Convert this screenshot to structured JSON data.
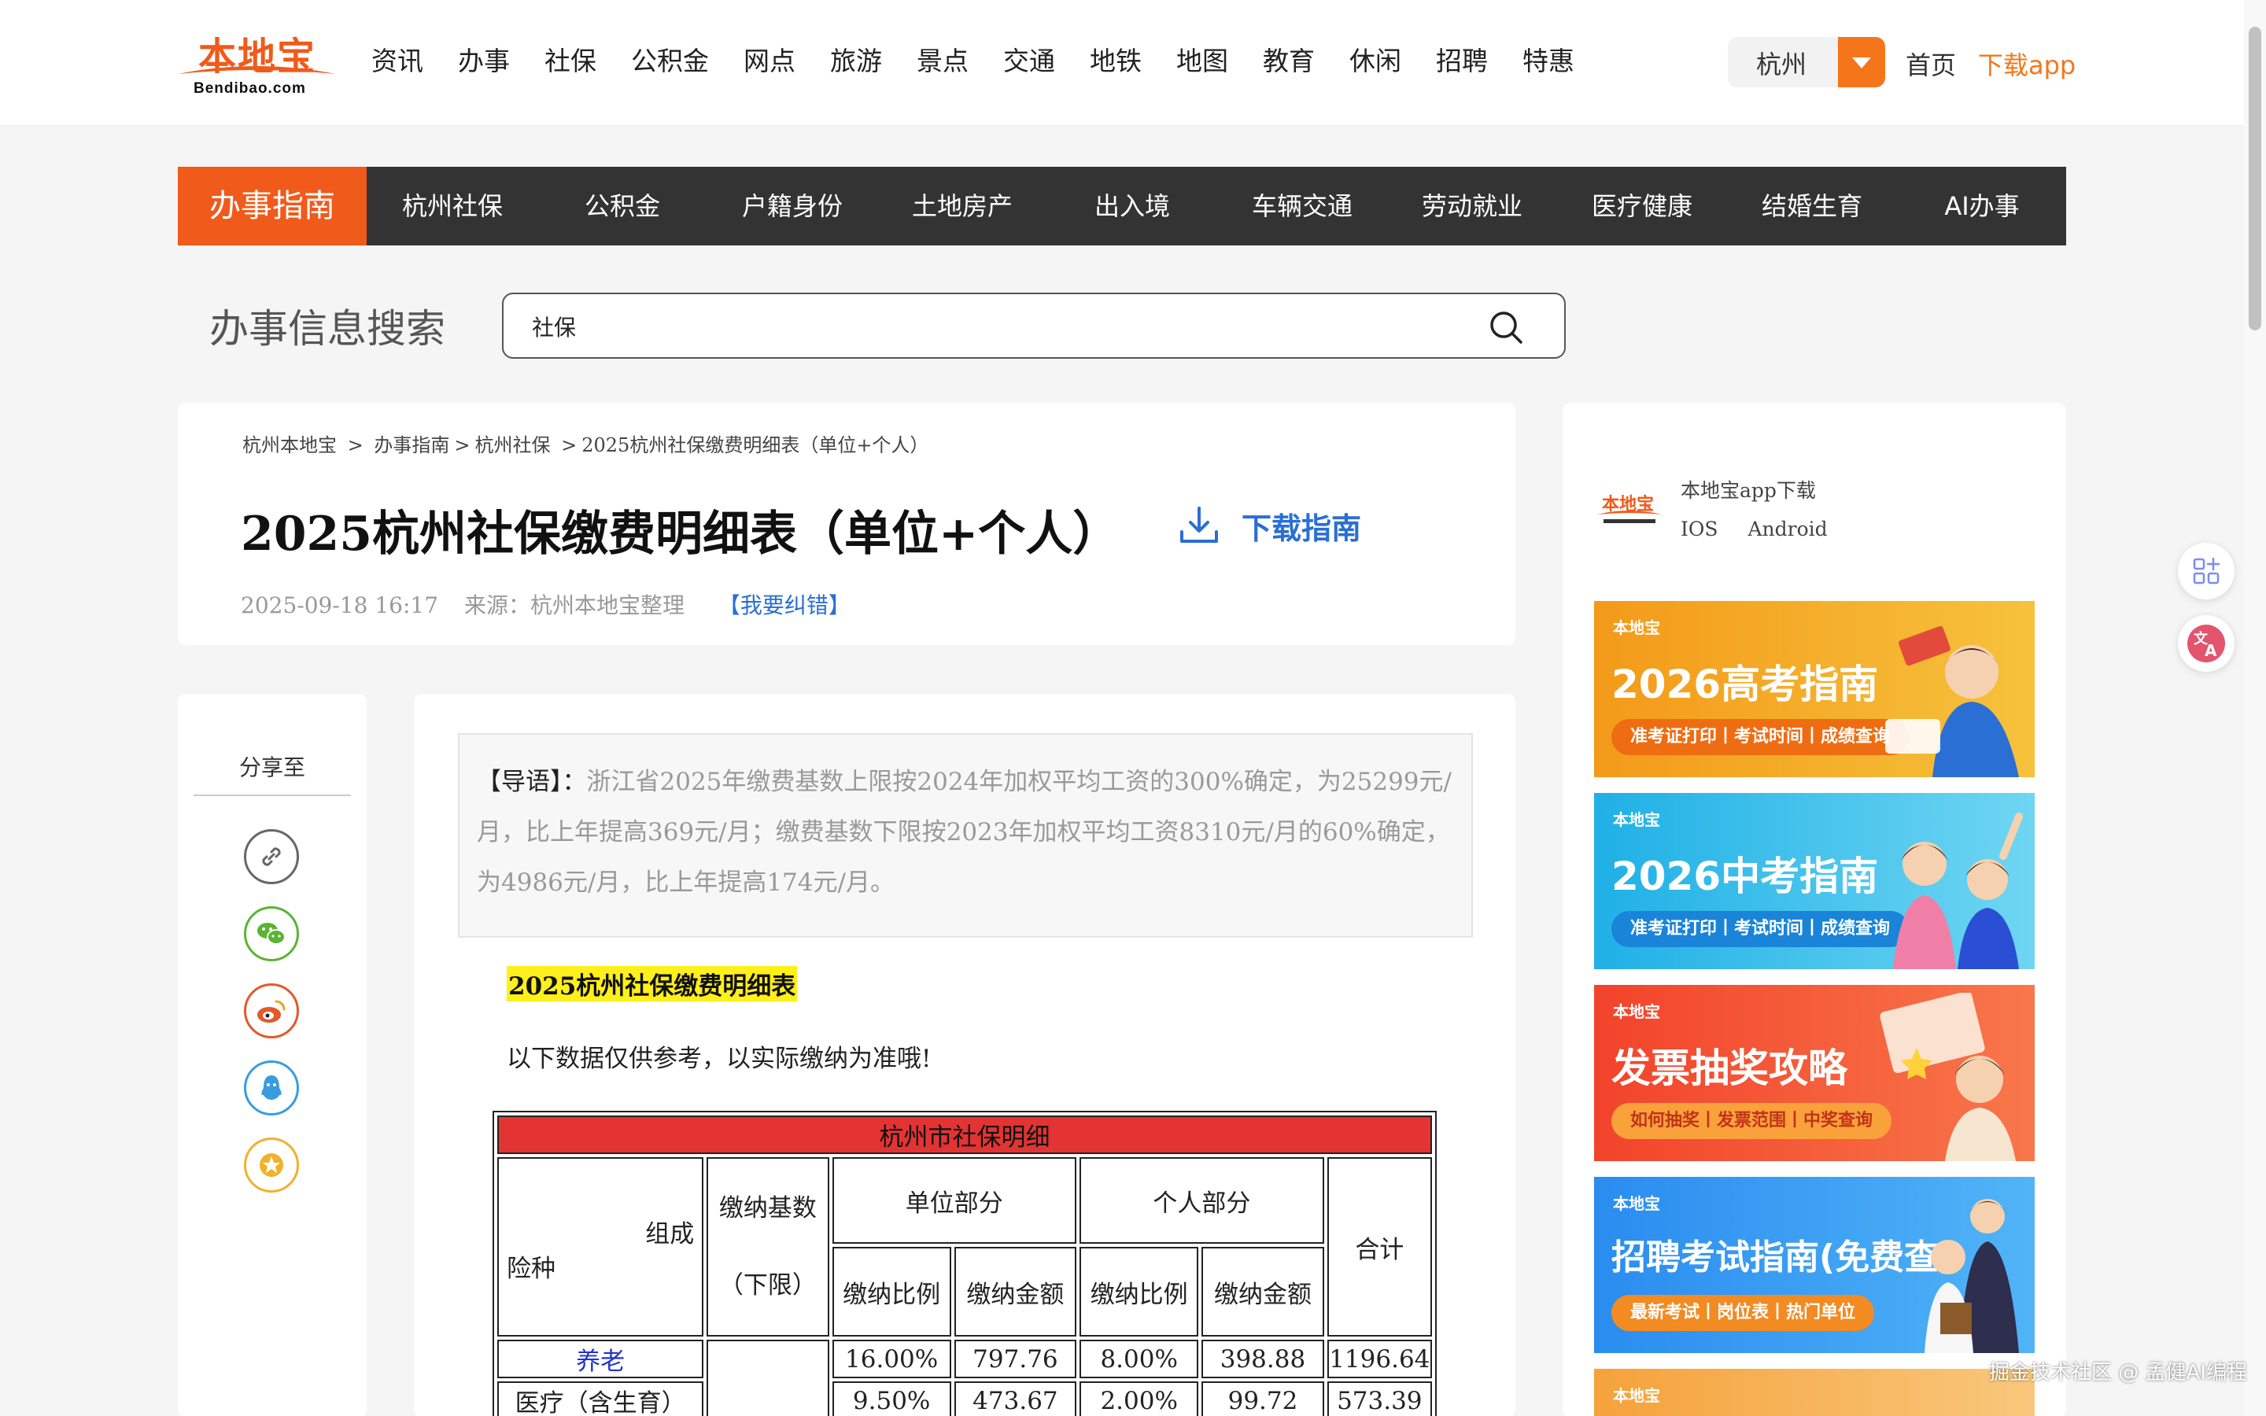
{
  "header": {
    "logo_text": "本地宝",
    "logo_sub": "Bendibao.com",
    "nav": [
      "资讯",
      "办事",
      "社保",
      "公积金",
      "网点",
      "旅游",
      "景点",
      "交通",
      "地铁",
      "地图",
      "教育",
      "休闲",
      "招聘",
      "特惠"
    ],
    "city": "杭州",
    "home": "首页",
    "download_app": "下载app"
  },
  "categories": [
    "办事指南",
    "杭州社保",
    "公积金",
    "户籍身份",
    "土地房产",
    "出入境",
    "车辆交通",
    "劳动就业",
    "医疗健康",
    "结婚生育",
    "AI办事"
  ],
  "search": {
    "label": "办事信息搜索",
    "value": "社保"
  },
  "breadcrumb": [
    "杭州本地宝",
    ">",
    "办事指南",
    ">",
    "杭州社保",
    ">",
    "2025杭州社保缴费明细表（单位+个人）"
  ],
  "article": {
    "title": "2025杭州社保缴费明细表（单位+个人）",
    "download_guide": "下载指南",
    "date": "2025-09-18 16:17",
    "source": "来源：杭州本地宝整理",
    "report": "【我要纠错】",
    "intro_lead": "【导语】：",
    "intro_text": "浙江省2025年缴费基数上限按2024年加权平均工资的300%确定，为25299元/月，比上年提高369元/月；缴费基数下限按2023年加权平均工资8310元/月的60%确定，为4986元/月，比上年提高174元/月。",
    "subtitle": "2025杭州社保缴费明细表",
    "note": "以下数据仅供参考，以实际缴纳为准哦!"
  },
  "share": {
    "title": "分享至",
    "buttons": [
      {
        "name": "link-icon",
        "color": "#666666"
      },
      {
        "name": "wechat-icon",
        "color": "#5ab433"
      },
      {
        "name": "weibo-icon",
        "color": "#e2592a"
      },
      {
        "name": "qq-icon",
        "color": "#3a9ce0"
      },
      {
        "name": "favorite-icon",
        "color": "#f0b22c"
      }
    ]
  },
  "table": {
    "caption": "杭州市社保明细",
    "corner_top": "组成",
    "corner_bottom": "险种",
    "base_header": "缴纳基数",
    "base_sub": "（下限）",
    "unit_header": "单位部分",
    "personal_header": "个人部分",
    "total_header": "合计",
    "ratio": "缴纳比例",
    "amount": "缴纳金额",
    "rows": [
      {
        "type": "养老",
        "unit_ratio": "16.00%",
        "unit_amount": "797.76",
        "p_ratio": "8.00%",
        "p_amount": "398.88",
        "total": "1196.64"
      },
      {
        "type": "医疗（含生育）",
        "unit_ratio": "9.50%",
        "unit_amount": "473.67",
        "p_ratio": "2.00%",
        "p_amount": "99.72",
        "total": "573.39"
      }
    ]
  },
  "sidebar": {
    "app_title": "本地宝app下载",
    "app_links": [
      "IOS",
      "Android"
    ],
    "banners": [
      {
        "brand": "本地宝",
        "title": "2026高考指南",
        "sub": "准考证打印丨考试时间丨成绩查询",
        "bg1": "#f7a21b",
        "bg2": "#f6c13b",
        "pill": "#ef6d12"
      },
      {
        "brand": "本地宝",
        "title": "2026中考指南",
        "sub": "准考证打印丨考试时间丨成绩查询",
        "bg1": "#1fb6e8",
        "bg2": "#67d2f0",
        "pill": "#1a84d8"
      },
      {
        "brand": "本地宝",
        "title": "发票抽奖攻略",
        "sub": "如何抽奖丨发票范围丨中奖查询",
        "bg1": "#f3492c",
        "bg2": "#f8754a",
        "pill": "#f9a13a"
      },
      {
        "brand": "本地宝",
        "title": "招聘考试指南(免费查)",
        "sub": "最新考试丨岗位表丨热门单位",
        "bg1": "#2a8ef0",
        "bg2": "#4ab0f6",
        "pill": "#f28b22"
      }
    ]
  },
  "watermark": "掘金技术社区 @ 孟健AI编程"
}
